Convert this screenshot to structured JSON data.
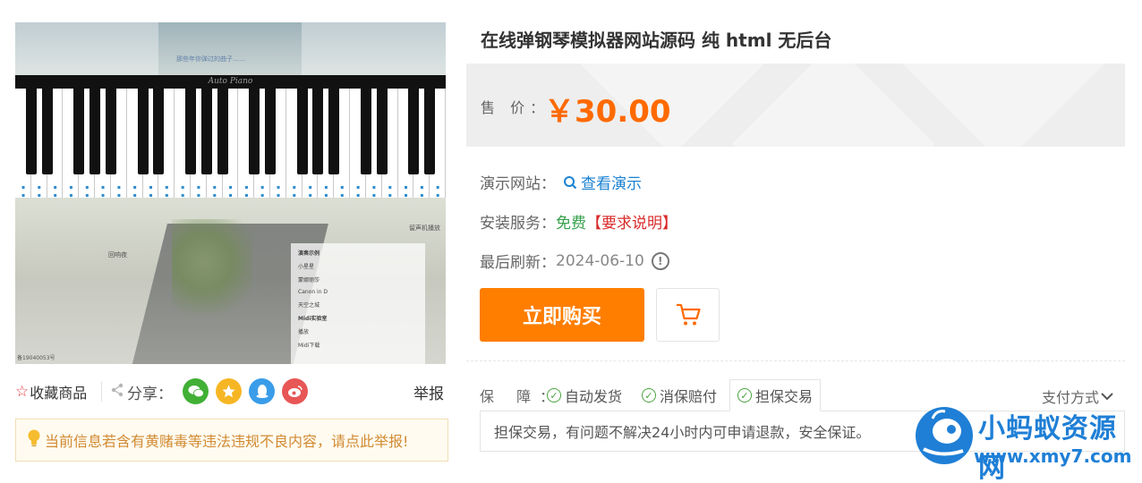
{
  "product": {
    "title": "在线弹钢琴模拟器网站源码 纯 html 无后台",
    "price_label": "售 价：",
    "price_value": "￥30.00"
  },
  "preview": {
    "overlay_top": "那些年你弹过的曲子……",
    "brand": "Auto Piano",
    "left_label": "回响夜",
    "right_label": "留声机播放",
    "menu_items": [
      "演奏示例",
      "小星星",
      "蒙娜丽莎",
      "Canon in D",
      "天空之城",
      "Midi实验室",
      "播放",
      "Midi下载"
    ],
    "icp": "备19040053号"
  },
  "actions": {
    "favorite_label": "收藏商品",
    "share_label": "分享：",
    "report_label": "举报",
    "notice_text": "当前信息若含有黄赌毒等违法违规不良内容，请点此举报!"
  },
  "details": {
    "demo_label": "演示网站：",
    "demo_link": "查看演示",
    "install_label": "安装服务：",
    "install_free": "免费",
    "install_req": "【要求说明】",
    "refresh_label": "最后刷新：",
    "refresh_date": "2024-06-10",
    "buy_button": "立即购买"
  },
  "guarantee": {
    "label": "保 障：",
    "tabs": [
      "自动发货",
      "消保赔付",
      "担保交易"
    ],
    "pay_method": "支付方式",
    "description": "担保交易，有问题不解决24小时内可申请退款，安全保证。"
  },
  "watermark": {
    "name": "小蚂蚁资源网",
    "url": "www.xmy7.com"
  },
  "colors": {
    "accent": "#ff7e00",
    "price": "#ff6a00",
    "link": "#1b82d2",
    "free": "#36a04b",
    "required": "#d92a2a"
  },
  "icons": {
    "favorite": "star-outline-icon",
    "wechat": "wechat-icon",
    "qzone": "qzone-star-icon",
    "qq": "qq-penguin-icon",
    "weibo": "weibo-icon",
    "notice": "lightbulb-icon",
    "demo": "search-icon",
    "refresh_info": "exclamation-circle-icon",
    "cart": "shopping-cart-icon",
    "check": "check-circle-icon",
    "chevron": "chevron-down-icon"
  }
}
